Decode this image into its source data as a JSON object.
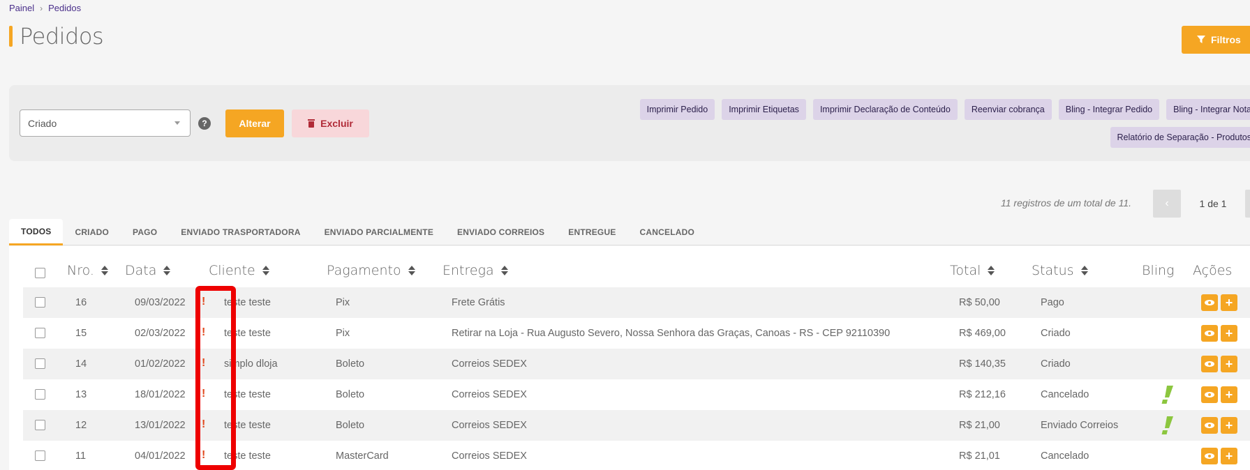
{
  "breadcrumb": {
    "home": "Painel",
    "current": "Pedidos"
  },
  "page": {
    "title": "Pedidos"
  },
  "filters_button": {
    "label": "Filtros"
  },
  "actions": {
    "status_select": {
      "value": "Criado"
    },
    "help": "?",
    "alter_label": "Alterar",
    "delete_label": "Excluir",
    "quick": [
      "Imprimir Pedido",
      "Imprimir Etiquetas",
      "Imprimir Declaração de Conteúdo",
      "Reenviar cobrança",
      "Bling - Integrar Pedido",
      "Bling - Integrar Nota",
      "Relatório de Separação - Produtos"
    ]
  },
  "pagination": {
    "info": "11 registros de um total de 11.",
    "label": "1 de 1",
    "prev": "‹",
    "next": "›"
  },
  "tabs": [
    "TODOS",
    "CRIADO",
    "PAGO",
    "ENVIADO TRASPORTADORA",
    "ENVIADO PARCIALMENTE",
    "ENVIADO CORREIOS",
    "ENTREGUE",
    "CANCELADO"
  ],
  "table": {
    "headers": {
      "nro": "Nro.",
      "data": "Data",
      "cliente": "Cliente",
      "pagamento": "Pagamento",
      "entrega": "Entrega",
      "total": "Total",
      "status": "Status",
      "bling": "Bling",
      "acoes": "Ações"
    },
    "rows": [
      {
        "nro": "16",
        "data": "09/03/2022",
        "cliente": "teste teste",
        "pagamento": "Pix",
        "entrega": "Frete Grátis",
        "total": "R$ 50,00",
        "status": "Pago",
        "bling": false
      },
      {
        "nro": "15",
        "data": "02/03/2022",
        "cliente": "teste teste",
        "pagamento": "Pix",
        "entrega": "Retirar na Loja - Rua Augusto Severo, Nossa Senhora das Graças, Canoas - RS - CEP 92110390",
        "total": "R$ 469,00",
        "status": "Criado",
        "bling": false
      },
      {
        "nro": "14",
        "data": "01/02/2022",
        "cliente": "simplo dloja",
        "pagamento": "Boleto",
        "entrega": "Correios SEDEX",
        "total": "R$ 140,35",
        "status": "Criado",
        "bling": false
      },
      {
        "nro": "13",
        "data": "18/01/2022",
        "cliente": "teste teste",
        "pagamento": "Boleto",
        "entrega": "Correios SEDEX",
        "total": "R$ 212,16",
        "status": "Cancelado",
        "bling": true
      },
      {
        "nro": "12",
        "data": "13/01/2022",
        "cliente": "teste teste",
        "pagamento": "Boleto",
        "entrega": "Correios SEDEX",
        "total": "R$ 21,00",
        "status": "Enviado Correios",
        "bling": true
      },
      {
        "nro": "11",
        "data": "04/01/2022",
        "cliente": "teste teste",
        "pagamento": "MasterCard",
        "entrega": "Correios SEDEX",
        "total": "R$ 21,01",
        "status": "Cancelado",
        "bling": false
      }
    ]
  },
  "colors": {
    "accent": "#f5a623",
    "danger_bg": "#f8d7da",
    "danger_text": "#b02a37",
    "quick_bg": "#dcd3e8",
    "warning": "#e04a1f",
    "bling_green": "#8cc63f",
    "highlight": "#ee0000"
  }
}
